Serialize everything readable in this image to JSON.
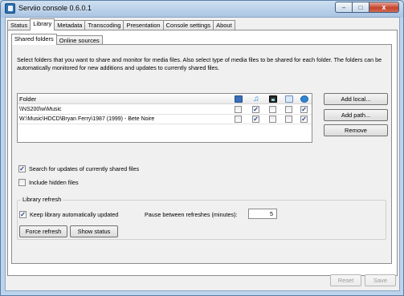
{
  "window": {
    "title": "Serviio console 0.6.0.1",
    "controls": {
      "minimize": "–",
      "maximize": "□",
      "close": "x"
    }
  },
  "tabs": [
    {
      "label": "Status"
    },
    {
      "label": "Library",
      "active": true
    },
    {
      "label": "Metadata"
    },
    {
      "label": "Transcoding"
    },
    {
      "label": "Presentation"
    },
    {
      "label": "Console settings"
    },
    {
      "label": "About"
    }
  ],
  "subtabs": [
    {
      "label": "Shared folders",
      "active": true
    },
    {
      "label": "Online sources"
    }
  ],
  "description": "Select folders that you want to share and monitor for media files. Also select type of media files to be shared for each folder. The folders can be automatically monitored for new additions and updates to currently shared files.",
  "table": {
    "header": "Folder",
    "column_icons": [
      "video-icon",
      "music-icon",
      "image-icon",
      "document-icon",
      "online-icon"
    ],
    "rows": [
      {
        "path": "\\\\NS200\\w\\Music",
        "checks": [
          false,
          true,
          false,
          false,
          true
        ]
      },
      {
        "path": "W:\\Music\\HDCD\\Bryan Ferry\\1987 (1999) - Bete Noire",
        "checks": [
          false,
          true,
          false,
          false,
          true
        ]
      }
    ]
  },
  "buttons": {
    "add_local": "Add local...",
    "add_path": "Add path...",
    "remove": "Remove",
    "force_refresh": "Force refresh",
    "show_status": "Show status",
    "reset": "Reset",
    "save": "Save"
  },
  "options": {
    "search_updates": {
      "label": "Search for updates of currently shared files",
      "checked": true
    },
    "include_hidden": {
      "label": "Include hidden files",
      "checked": false
    }
  },
  "library_refresh": {
    "title": "Library refresh",
    "keep_updated": {
      "label": "Keep library automatically updated",
      "checked": true
    },
    "pause_label": "Pause between refreshes (minutes):",
    "pause_value": "5"
  },
  "colors": {
    "accent": "#1d3f8a",
    "panel": "#f0f0f0",
    "frame": "#bcd3ec"
  }
}
